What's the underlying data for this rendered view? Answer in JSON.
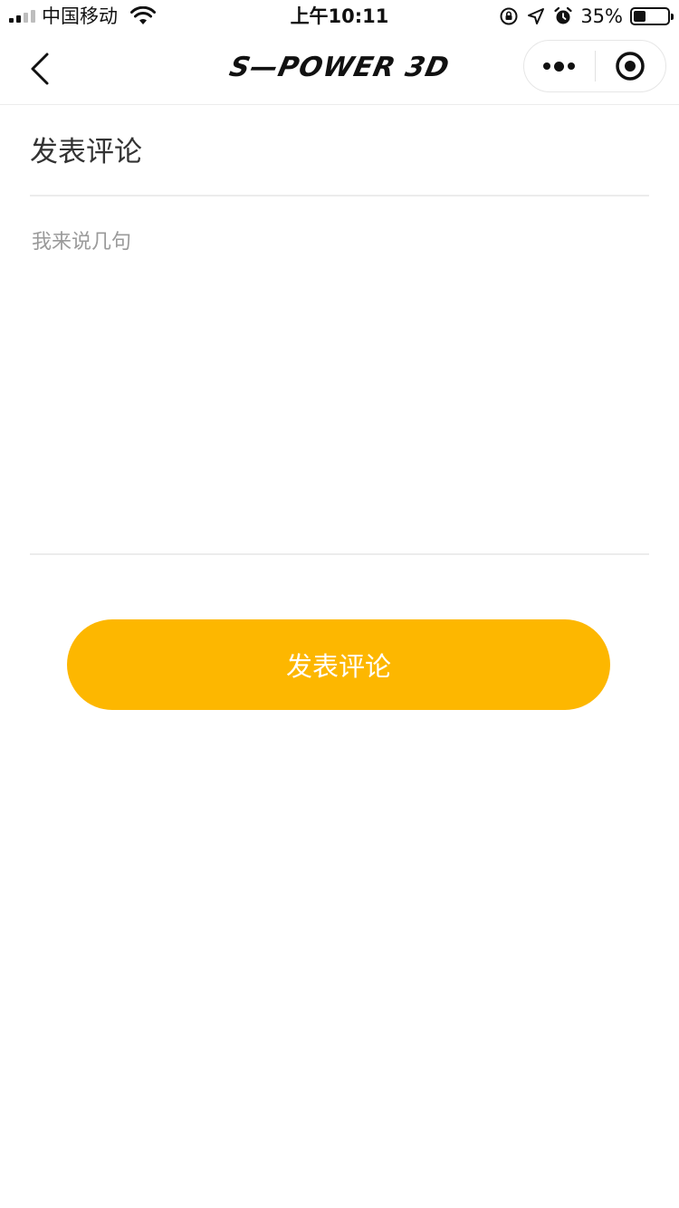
{
  "status_bar": {
    "carrier": "中国移动",
    "time": "上午10:11",
    "battery_percent": "35%",
    "battery_level": 0.35,
    "icons": [
      "signal-icon",
      "wifi-icon",
      "orientation-lock-icon",
      "location-arrow-icon",
      "alarm-icon",
      "battery-icon"
    ]
  },
  "nav": {
    "brand": "S—POWER 3D",
    "back_icon": "chevron-left-icon",
    "more_icon": "more-dots-icon",
    "close_icon": "target-circle-icon"
  },
  "form": {
    "title": "发表评论",
    "comment_placeholder": "我来说几句",
    "comment_value": "",
    "submit_label": "发表评论"
  },
  "colors": {
    "accent": "#fdb700",
    "text": "#333333",
    "placeholder": "#9a9a9a",
    "divider": "#ececec"
  }
}
